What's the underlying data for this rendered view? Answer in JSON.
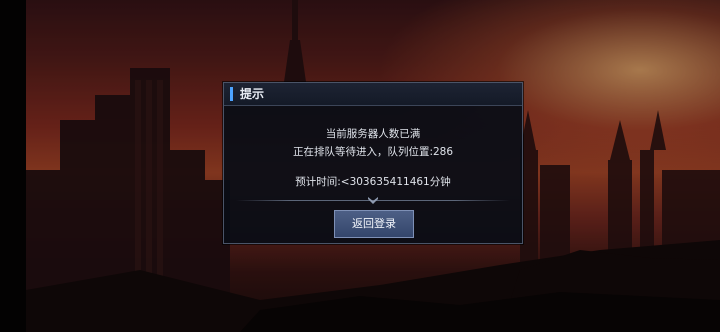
{
  "dialog": {
    "title": "提示",
    "message_line1": "当前服务器人数已满",
    "message_line2": "正在排队等待进入，队列位置:286",
    "message_line3": "预计时间:<303635411461分钟",
    "return_button_label": "返回登录"
  },
  "colors": {
    "accent": "#4da3ff",
    "button": "#3e507a",
    "panel": "#090d16"
  },
  "icons": {
    "divider": "chevron-down-icon"
  }
}
